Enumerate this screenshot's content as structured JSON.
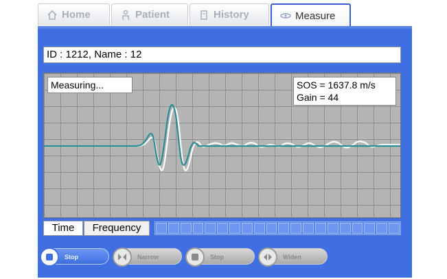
{
  "tabs": [
    {
      "label": "Home",
      "icon": "home-icon",
      "active": false
    },
    {
      "label": "Patient",
      "icon": "patient-icon",
      "active": false
    },
    {
      "label": "History",
      "icon": "history-icon",
      "active": false
    },
    {
      "label": "Measure",
      "icon": "measure-icon",
      "active": true
    }
  ],
  "patient": {
    "id_line": "ID : 1212, Name : 12"
  },
  "plot": {
    "status": "Measuring...",
    "sos": "SOS = 1637.8 m/s",
    "gain": "Gain = 44"
  },
  "modes": {
    "time": "Time",
    "frequency": "Frequency"
  },
  "progress": {
    "segments": 20
  },
  "controls": {
    "stop1": "Stop",
    "narrow": "Narrow",
    "stop2": "Stop",
    "widen": "Widen"
  },
  "colors": {
    "panel": "#3f6fe0",
    "signal_teal": "#2d8c95",
    "signal_white": "#ffffff",
    "grid_bg": "#b5b5b5"
  }
}
